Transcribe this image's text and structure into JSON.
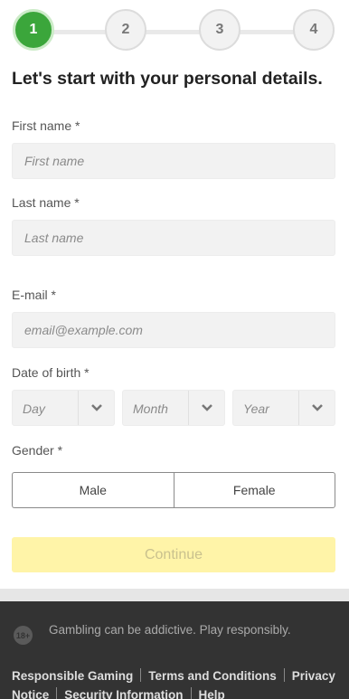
{
  "stepper": {
    "steps": [
      "1",
      "2",
      "3",
      "4"
    ],
    "active": 1
  },
  "heading": "Let's start with your personal details.",
  "form": {
    "first_name": {
      "label": "First name *",
      "placeholder": "First name"
    },
    "last_name": {
      "label": "Last name *",
      "placeholder": "Last name"
    },
    "email": {
      "label": "E-mail *",
      "placeholder": "email@example.com"
    },
    "dob": {
      "label": "Date of birth *",
      "day": "Day",
      "month": "Month",
      "year": "Year"
    },
    "gender": {
      "label": "Gender *",
      "options": [
        "Male",
        "Female"
      ]
    },
    "continue_label": "Continue"
  },
  "footer": {
    "age_badge": "18+",
    "warning": "Gambling can be addictive. Play responsibly.",
    "links": [
      "Responsible Gaming",
      "Terms and Conditions",
      "Privacy Notice",
      "Security Information",
      "Help"
    ]
  },
  "colors": {
    "accent": "#3ba63b",
    "continue_bg": "#fff4a8",
    "footer_bg": "#333333"
  }
}
